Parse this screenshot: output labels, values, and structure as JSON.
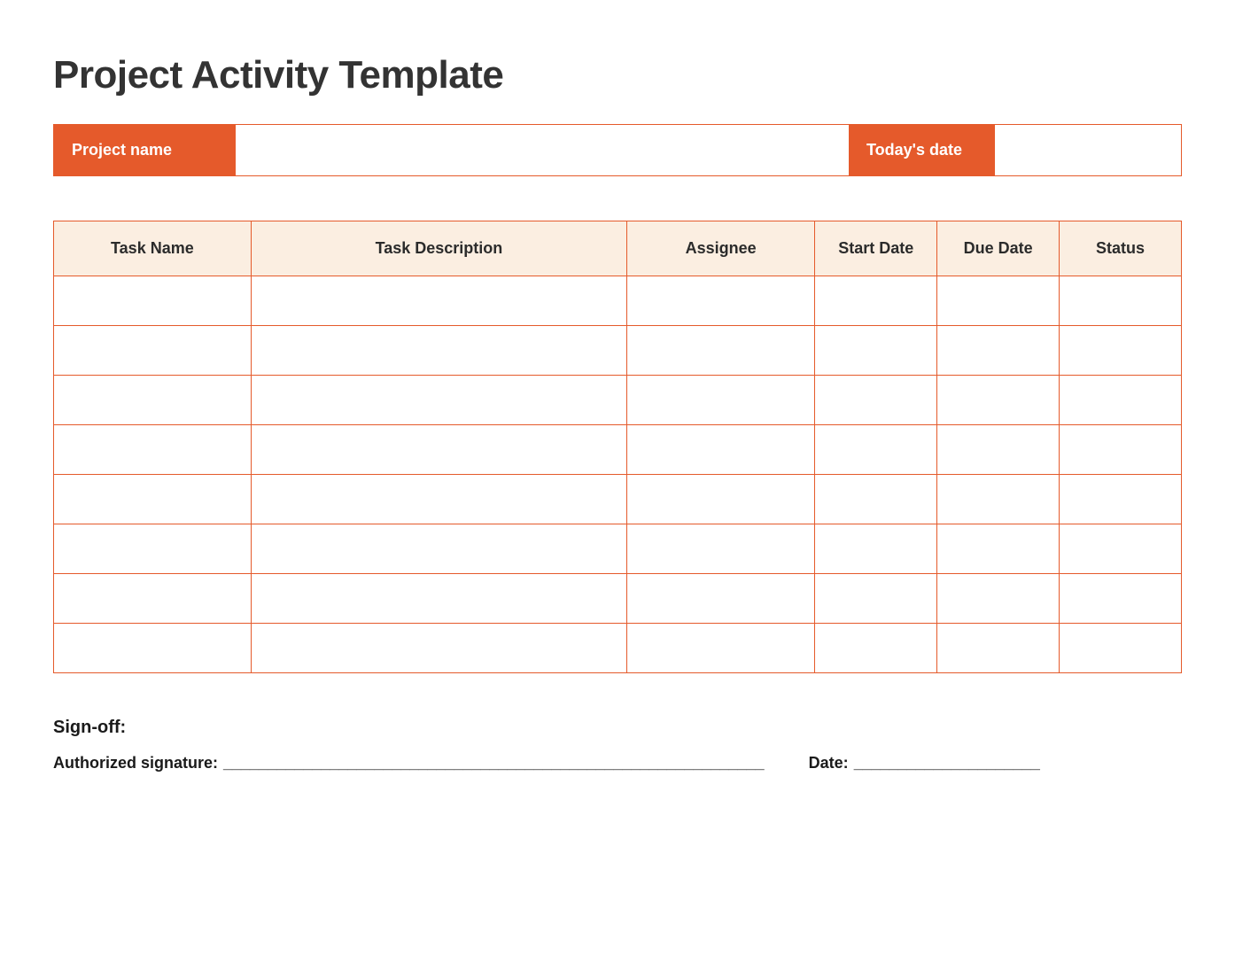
{
  "title": "Project Activity Template",
  "info": {
    "project_label": "Project name",
    "project_value": "",
    "date_label": "Today's date",
    "date_value": ""
  },
  "columns": {
    "task_name": "Task Name",
    "task_description": "Task Description",
    "assignee": "Assignee",
    "start_date": "Start Date",
    "due_date": "Due Date",
    "status": "Status"
  },
  "rows": [
    {
      "task_name": "",
      "task_description": "",
      "assignee": "",
      "start_date": "",
      "due_date": "",
      "status": ""
    },
    {
      "task_name": "",
      "task_description": "",
      "assignee": "",
      "start_date": "",
      "due_date": "",
      "status": ""
    },
    {
      "task_name": "",
      "task_description": "",
      "assignee": "",
      "start_date": "",
      "due_date": "",
      "status": ""
    },
    {
      "task_name": "",
      "task_description": "",
      "assignee": "",
      "start_date": "",
      "due_date": "",
      "status": ""
    },
    {
      "task_name": "",
      "task_description": "",
      "assignee": "",
      "start_date": "",
      "due_date": "",
      "status": ""
    },
    {
      "task_name": "",
      "task_description": "",
      "assignee": "",
      "start_date": "",
      "due_date": "",
      "status": ""
    },
    {
      "task_name": "",
      "task_description": "",
      "assignee": "",
      "start_date": "",
      "due_date": "",
      "status": ""
    },
    {
      "task_name": "",
      "task_description": "",
      "assignee": "",
      "start_date": "",
      "due_date": "",
      "status": ""
    }
  ],
  "signoff": {
    "header": "Sign-off:",
    "signature_label": "Authorized signature:",
    "signature_blank": "_____________________________________________________________",
    "date_label": "Date:",
    "date_blank": "_____________________"
  }
}
